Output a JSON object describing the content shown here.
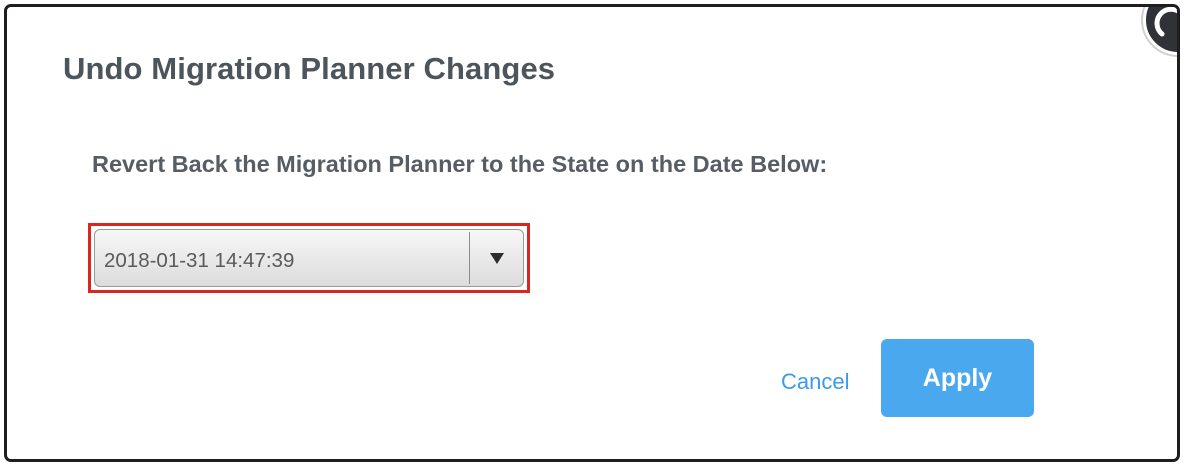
{
  "dialog": {
    "title": "Undo Migration Planner Changes",
    "prompt": "Revert Back the Migration Planner to the State on the Date Below:",
    "date_select": {
      "value": "2018-01-31 14:47:39",
      "arrow_icon": "triangle-down-icon"
    },
    "cancel_label": "Cancel",
    "apply_label": "Apply",
    "close_icon": "close-icon"
  },
  "colors": {
    "title_text": "#4c545c",
    "highlight_border": "#d8271c",
    "link_blue": "#3a9be8",
    "apply_button": "#4aa8ef",
    "close_button": "#2f3337"
  }
}
